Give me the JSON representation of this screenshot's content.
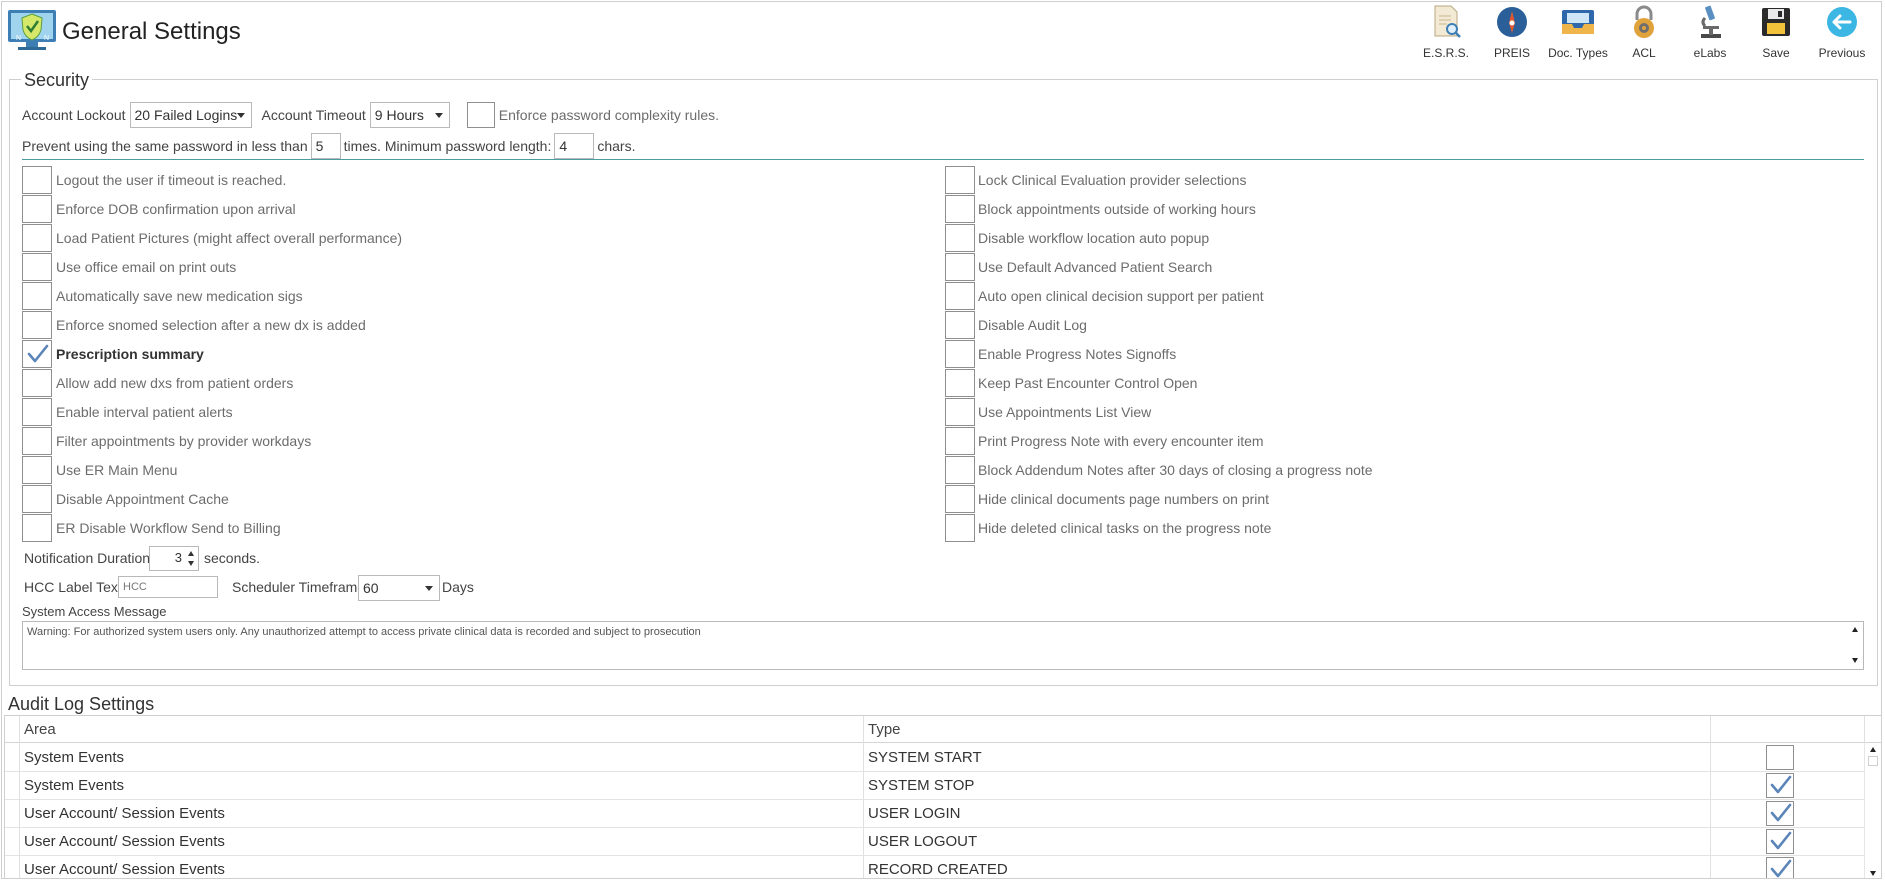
{
  "app": {
    "title": "General Settings",
    "logo_icon": "monitor-shield-logo-icon"
  },
  "toolbar": [
    {
      "label": "E.S.R.S.",
      "icon": "document-search-icon"
    },
    {
      "label": "PREIS",
      "icon": "compass-pin-icon"
    },
    {
      "label": "Doc. Types",
      "icon": "inbox-tray-icon"
    },
    {
      "label": "ACL",
      "icon": "padlock-icon"
    },
    {
      "label": "eLabs",
      "icon": "microscope-icon"
    },
    {
      "label": "Save",
      "icon": "floppy-disk-icon"
    },
    {
      "label": "Previous",
      "icon": "back-arrow-icon"
    }
  ],
  "security": {
    "legend": "Security",
    "account_lockout_label": "Account Lockout",
    "account_lockout_value": "20 Failed Logins",
    "account_timeout_label": "Account Timeout",
    "account_timeout_value": "9 Hours",
    "enforce_complexity_label": "Enforce password complexity rules.",
    "prevent_reuse_prefix": "Prevent using the same password in less than",
    "prevent_reuse_value": "5",
    "prevent_reuse_suffix": "times. Minimum password length:",
    "min_length_value": "4",
    "min_length_suffix": "chars.",
    "left_options": [
      {
        "label": "Logout the user if timeout is reached.",
        "checked": false
      },
      {
        "label": "Enforce DOB confirmation upon arrival",
        "checked": false
      },
      {
        "label": "Load Patient Pictures (might affect overall performance)",
        "checked": false
      },
      {
        "label": "Use office email on print outs",
        "checked": false
      },
      {
        "label": "Automatically save new medication sigs",
        "checked": false
      },
      {
        "label": "Enforce snomed selection after a new dx is added",
        "checked": false
      },
      {
        "label": "Prescription summary",
        "checked": true
      },
      {
        "label": "Allow add new dxs from patient orders",
        "checked": false
      },
      {
        "label": "Enable interval patient alerts",
        "checked": false
      },
      {
        "label": "Filter appointments by provider workdays",
        "checked": false
      },
      {
        "label": "Use ER Main Menu",
        "checked": false
      },
      {
        "label": "Disable Appointment Cache",
        "checked": false
      },
      {
        "label": "ER Disable Workflow Send to Billing",
        "checked": false
      }
    ],
    "right_options": [
      {
        "label": "Lock Clinical Evaluation provider selections",
        "checked": false
      },
      {
        "label": "Block appointments outside of working hours",
        "checked": false
      },
      {
        "label": "Disable workflow location auto popup",
        "checked": false
      },
      {
        "label": "Use Default Advanced Patient Search",
        "checked": false
      },
      {
        "label": "Auto open clinical decision support per patient",
        "checked": false
      },
      {
        "label": "Disable Audit Log",
        "checked": false
      },
      {
        "label": "Enable Progress Notes Signoffs",
        "checked": false
      },
      {
        "label": "Keep Past Encounter Control Open",
        "checked": false
      },
      {
        "label": "Use Appointments List View",
        "checked": false
      },
      {
        "label": "Print Progress Note with every encounter item",
        "checked": false
      },
      {
        "label": "Block Addendum Notes after 30 days of closing a progress note",
        "checked": false
      },
      {
        "label": "Hide clinical documents page numbers on print",
        "checked": false
      },
      {
        "label": "Hide deleted clinical tasks on the progress note",
        "checked": false
      }
    ],
    "notification_label": "Notification Duration",
    "notification_value": "3",
    "notification_suffix": "seconds.",
    "hcc_label": "HCC Label Text:",
    "hcc_placeholder": "HCC",
    "scheduler_label": "Scheduler Timeframe",
    "scheduler_value": "60",
    "scheduler_suffix": "Days",
    "system_access_label": "System Access Message",
    "system_access_message": "Warning: For authorized system users only. Any unauthorized attempt to access private clinical data is recorded and subject to prosecution"
  },
  "audit": {
    "title": "Audit Log Settings",
    "columns": [
      "Area",
      "Type",
      ""
    ],
    "rows": [
      {
        "area": "System Events",
        "type": "SYSTEM START",
        "enabled": false
      },
      {
        "area": "System Events",
        "type": "SYSTEM STOP",
        "enabled": true
      },
      {
        "area": "User Account/ Session Events",
        "type": "USER LOGIN",
        "enabled": true
      },
      {
        "area": "User Account/ Session Events",
        "type": "USER LOGOUT",
        "enabled": true
      },
      {
        "area": "User Account/ Session Events",
        "type": "RECORD CREATED",
        "enabled": true
      }
    ]
  },
  "colors": {
    "check": "#5b84b8",
    "accent_line": "#4a9ea2",
    "border": "#cfcfcf"
  }
}
